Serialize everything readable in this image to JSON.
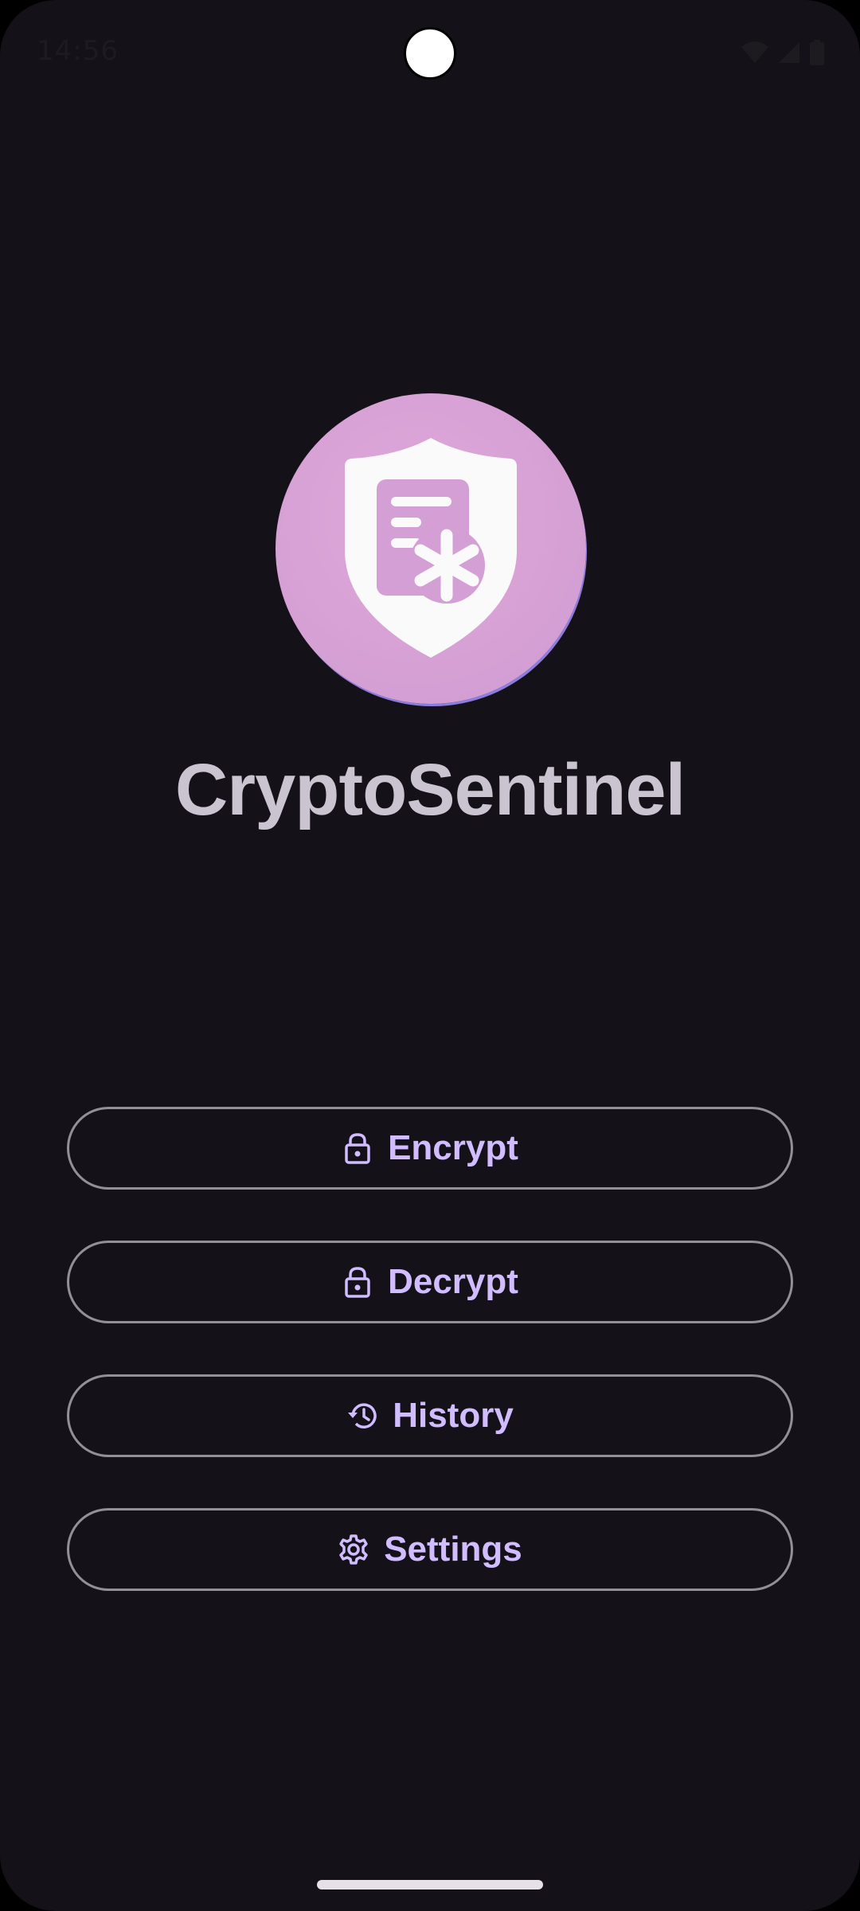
{
  "status_bar": {
    "time": "14:56",
    "icons": [
      "wifi-icon",
      "signal-icon",
      "battery-icon"
    ]
  },
  "app": {
    "title": "CryptoSentinel",
    "logo_icon": "shield-document-asterisk-icon"
  },
  "menu": {
    "items": [
      {
        "label": "Encrypt",
        "icon": "lock-icon"
      },
      {
        "label": "Decrypt",
        "icon": "lock-icon"
      },
      {
        "label": "History",
        "icon": "history-icon"
      },
      {
        "label": "Settings",
        "icon": "gear-icon"
      }
    ]
  },
  "colors": {
    "background": "#141218",
    "button_text": "#d0bcff",
    "button_outline": "#938f99",
    "title": "#cac4d0",
    "logo_bg": "#d49fd4"
  }
}
